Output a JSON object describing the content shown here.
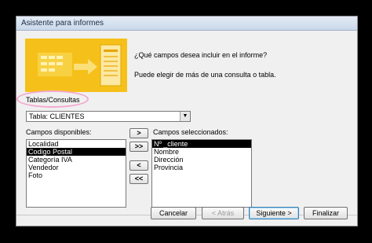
{
  "window": {
    "title": "Asistente para informes"
  },
  "header": {
    "question": "¿Qué campos desea incluir en el informe?",
    "note": "Puede elegir de más de una consulta o tabla."
  },
  "tables": {
    "label": "Tablas/Consultas",
    "selected": "Tabla: CLIENTES"
  },
  "available": {
    "label": "Campos disponibles:",
    "items": [
      "Localidad",
      "Codigo Postal",
      "Categoría IVA",
      "Vendedor",
      "Foto"
    ],
    "selected_item": "Codigo Postal"
  },
  "selected": {
    "label": "Campos seleccionados:",
    "items": [
      "Nº _cliente",
      "Nombre",
      "Dirección",
      "Provincia"
    ],
    "selected_item": "Nº _cliente"
  },
  "move_buttons": {
    "add_one": ">",
    "add_all": ">>",
    "remove_one": "<",
    "remove_all": "<<"
  },
  "actions": {
    "cancel": "Cancelar",
    "back": "< Atrás",
    "next": "Siguiente >",
    "finish": "Finalizar"
  },
  "colors": {
    "banner": "#f6c01a",
    "highlight_ellipse": "#f4a8cf",
    "selection": "#000000"
  }
}
